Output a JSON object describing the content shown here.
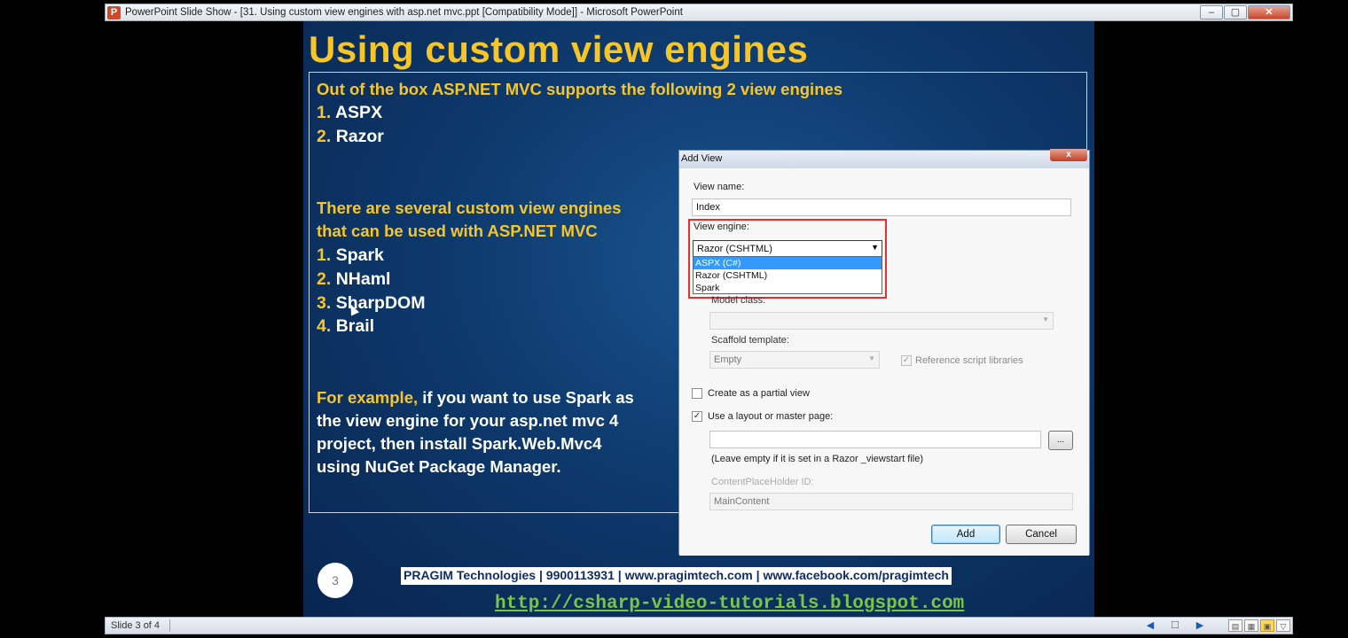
{
  "window": {
    "app_icon": "P",
    "title": "PowerPoint Slide Show - [31. Using custom view engines with asp.net mvc.ppt [Compatibility Mode]] - Microsoft PowerPoint",
    "min": "–",
    "max": "▢",
    "close": "✕"
  },
  "slide": {
    "title": "Using custom view engines",
    "intro": "Out of the box ASP.NET MVC supports the following 2 view engines",
    "builtin": [
      {
        "num": "1.",
        "name": "ASPX"
      },
      {
        "num": "2.",
        "name": "Razor"
      }
    ],
    "custom_intro_1": "There are several custom view engines",
    "custom_intro_2": "that can be used with ASP.NET MVC",
    "custom": [
      {
        "num": "1.",
        "name": "Spark"
      },
      {
        "num": "2.",
        "name": "NHaml"
      },
      {
        "num": "3.",
        "name": "SharpDOM"
      },
      {
        "num": "4.",
        "name": "Brail"
      }
    ],
    "example_lead": "For example,",
    "example_1": " if you want to use Spark as",
    "example_2": "the view engine for your asp.net mvc 4",
    "example_3": "project, then install Spark.Web.Mvc4",
    "example_4": "using NuGet Package Manager.",
    "number": "3",
    "footer": "PRAGIM Technologies | 9900113931 | www.pragimtech.com | www.facebook.com/pragimtech",
    "link": "http://csharp-video-tutorials.blogspot.com"
  },
  "dialog": {
    "caption": "Add View",
    "close": "x",
    "view_name_label": "View name:",
    "view_name_value": "Index",
    "view_engine_label": "View engine:",
    "view_engine_selected": "Razor (CSHTML)",
    "view_engine_options": [
      "ASPX (C#)",
      "Razor (CSHTML)",
      "Spark"
    ],
    "model_class_label": "Model class:",
    "scaffold_label": "Scaffold template:",
    "scaffold_value": "Empty",
    "reference_scripts_label": "Reference script libraries",
    "partial_view_label": "Create as a partial view",
    "partial_view_checked": false,
    "use_layout_label": "Use a layout or master page:",
    "use_layout_checked": true,
    "browse_label": "...",
    "layout_hint": "(Leave empty if it is set in a Razor _viewstart file)",
    "placeholder_label": "ContentPlaceHolder ID:",
    "placeholder_value": "MainContent",
    "add_button": "Add",
    "cancel_button": "Cancel"
  },
  "statusbar": {
    "slide_count": "Slide 3 of 4"
  },
  "colors": {
    "title_yellow": "#f7c626",
    "slide_blue": "#0e3a6e",
    "highlight_red": "#e03232",
    "link_green": "#79c646"
  }
}
